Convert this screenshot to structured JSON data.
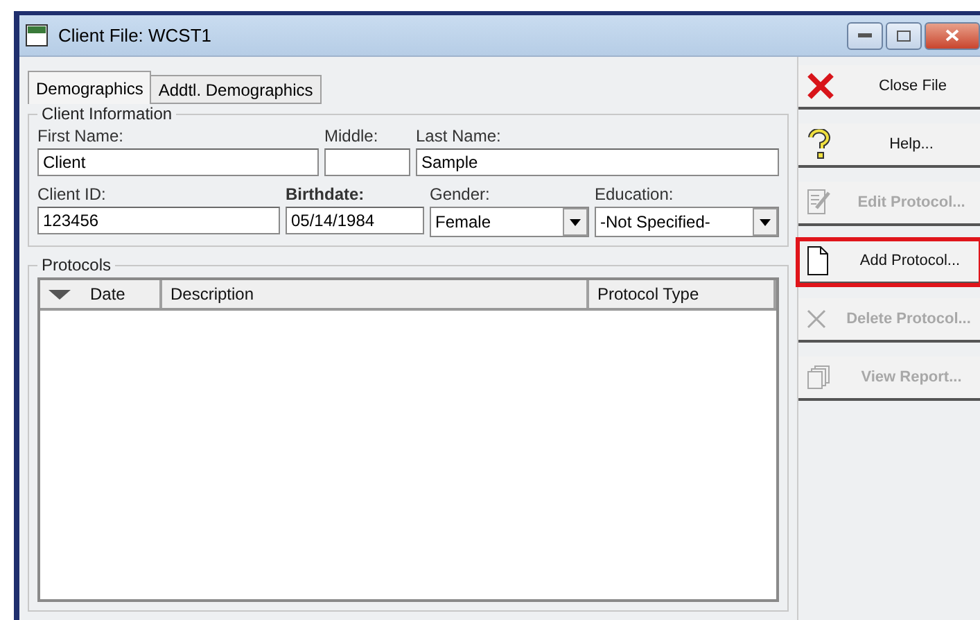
{
  "window": {
    "title": "Client File: WCST1"
  },
  "tabs": [
    {
      "label": "Demographics",
      "selected": true
    },
    {
      "label": "Addtl. Demographics",
      "selected": false
    }
  ],
  "client_information": {
    "title": "Client Information",
    "first_name": {
      "label": "First Name:",
      "value": "Client"
    },
    "middle": {
      "label": "Middle:"
    },
    "last_name": {
      "label": "Last Name:",
      "value": "Sample"
    },
    "client_id": {
      "label": "Client ID:",
      "value": "123456"
    },
    "birthdate": {
      "label": "Birthdate:",
      "value": "05/14/1984"
    },
    "gender": {
      "label": "Gender:",
      "value": "Female"
    },
    "education": {
      "label": "Education:",
      "value": "-Not Specified-"
    }
  },
  "protocols": {
    "title": "Protocols",
    "columns": [
      {
        "label": "Date",
        "sorted": true
      },
      {
        "label": "Description",
        "sorted": false
      },
      {
        "label": "Protocol Type",
        "sorted": false
      }
    ]
  },
  "actions": [
    {
      "label": "Close File",
      "kind": "close",
      "disabled": false,
      "highlighted": false
    },
    {
      "label": "Help...",
      "kind": "help",
      "disabled": false,
      "highlighted": false
    },
    {
      "label": "Edit Protocol...",
      "kind": "edit",
      "disabled": true,
      "highlighted": false
    },
    {
      "label": "Add Protocol...",
      "kind": "add",
      "disabled": false,
      "highlighted": true
    },
    {
      "label": "Delete Protocol...",
      "kind": "delete",
      "disabled": true,
      "highlighted": false
    },
    {
      "label": "View Report...",
      "kind": "report",
      "disabled": true,
      "highlighted": false
    }
  ]
}
